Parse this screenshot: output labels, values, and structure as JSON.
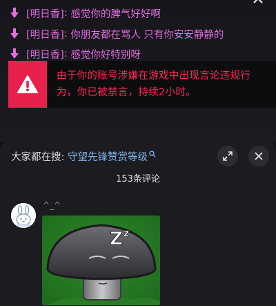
{
  "game_chat": {
    "messages": [
      {
        "speaker": "[明日香]",
        "text": "感觉你的脾气好好啊"
      },
      {
        "speaker": "[明日香]",
        "text": "你朋友都在骂人 只有你安安静静的"
      },
      {
        "speaker": "[明日香]",
        "text": "感觉你好特别呀"
      }
    ],
    "separator": ": ",
    "ban_notice": {
      "text": "由于你的账号涉嫌在游戏中出现言论违规行为，你已被禁言，持续2小时。",
      "icon": "warning-icon"
    }
  },
  "comment_sheet": {
    "search_prefix": "大家都在搜: ",
    "search_term": "守望先锋赞赏等级",
    "comment_count": "153条评论",
    "comments": [
      {
        "username": "^_^",
        "image": "doom-shroom-sleeping-sticker"
      }
    ],
    "icons": {
      "expand": "expand-icon",
      "close": "close-icon",
      "search": "search-icon"
    }
  },
  "colors": {
    "chat_text": "#e56be0",
    "ban_red": "#e8214c",
    "ban_text": "#ff2a55",
    "search_term": "#7fb3ec",
    "sheet_bg": "#1c1c20"
  }
}
